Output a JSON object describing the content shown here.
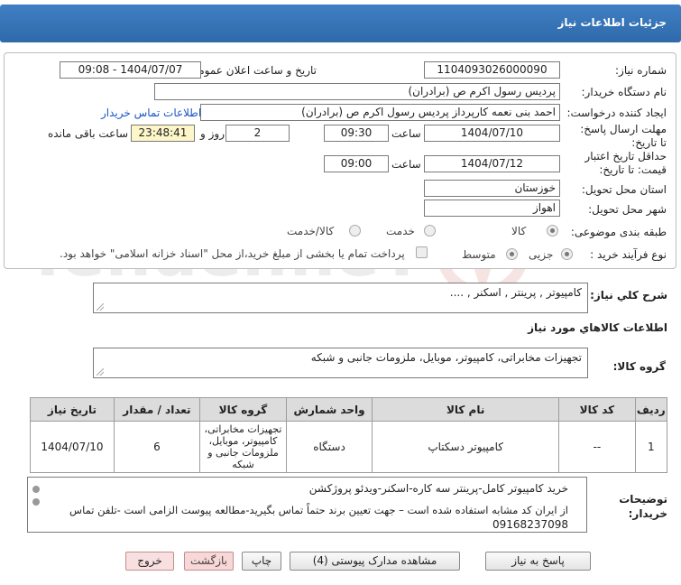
{
  "header": {
    "title": "جزئیات اطلاعات نیاز"
  },
  "form": {
    "need_number_label": "شماره نیاز:",
    "need_number": "1104093026000090",
    "announce_label": "تاریخ و ساعت اعلان عمومی:",
    "announce_value": "1404/07/07 - 09:08",
    "buyer_org_label": "نام دستگاه خریدار:",
    "buyer_org": "پردیس رسول اکرم ص (برادران)",
    "creator_label": "ایجاد کننده درخواست:",
    "creator": "احمد بنی نعمه کارپرداز پردیس رسول اکرم ص (برادران)",
    "contact_link": "اطلاعات تماس خریدار",
    "deadline_label": "مهلت ارسال پاسخ: تا تاریخ:",
    "deadline_date": "1404/07/10",
    "time_label": "ساعت",
    "deadline_time": "09:30",
    "days_value": "2",
    "days_label": "روز و",
    "remaining_time": "23:48:41",
    "remaining_label": "ساعت باقی مانده",
    "validity_label": "حداقل تاریخ اعتبار قیمت: تا تاریخ:",
    "validity_date": "1404/07/12",
    "validity_time": "09:00",
    "province_label": "استان محل تحویل:",
    "province": "خوزستان",
    "city_label": "شهر محل تحویل:",
    "city": "اهواز",
    "category_label": "طبقه بندی موضوعی:",
    "category_options": [
      "کالا",
      "خدمت",
      "کالا/خدمت"
    ],
    "category_selected": "کالا",
    "process_label": "نوع فرآیند خرید :",
    "process_options": [
      "جزیی",
      "متوسط"
    ],
    "process_selected": "جزیی",
    "payment_note": "پرداخت تمام یا بخشی از مبلغ خرید،از محل \"اسناد خزانه اسلامی\" خواهد بود."
  },
  "watermark": {
    "text": "AriaTender.neT"
  },
  "summary": {
    "label": "شرح کلي نياز:",
    "value": "کامپیوتر , پرینتر , اسکنر , ...."
  },
  "goods": {
    "section_title": "اطلاعات کالاهاي مورد نياز",
    "group_label": "گروه کالا:",
    "group_value": "تجهیزات مخابراتی، کامپیوتر، موبایل، ملزومات جانبی و شبکه"
  },
  "table": {
    "headers": [
      "ردیف",
      "کد کالا",
      "نام کالا",
      "واحد شمارش",
      "گروه کالا",
      "تعداد / مقدار",
      "تاریخ نیاز"
    ],
    "rows": [
      [
        "1",
        "--",
        "کامپیوتر دسکتاپ",
        "دستگاه",
        "تجهیزات مخابراتی، کامپیوتر، موبایل، ملزومات جانبی و شبکه",
        "6",
        "1404/07/10"
      ]
    ]
  },
  "notes": {
    "label": "توضیحات خریدار:",
    "line1": "خرید کامپیوتر کامل-پرینتر سه کاره-اسکنر-ویدئو پروژکشن",
    "line2": "از ایران کد مشابه استفاده شده است – جهت تعیین برند حتماً تماس بگیرید-مطالعه پیوست الزامی است -تلفن تماس",
    "line3": "09168237098"
  },
  "buttons": {
    "reply": "پاسخ به نیاز",
    "attachments": "مشاهده مدارک پیوستی (4)",
    "print": "چاپ",
    "back": "بازگشت",
    "exit": "خروج"
  },
  "colors": {
    "header_bg": "#3577ba",
    "link": "#1a56c5",
    "remaining_bg": "#fdf6c8"
  }
}
